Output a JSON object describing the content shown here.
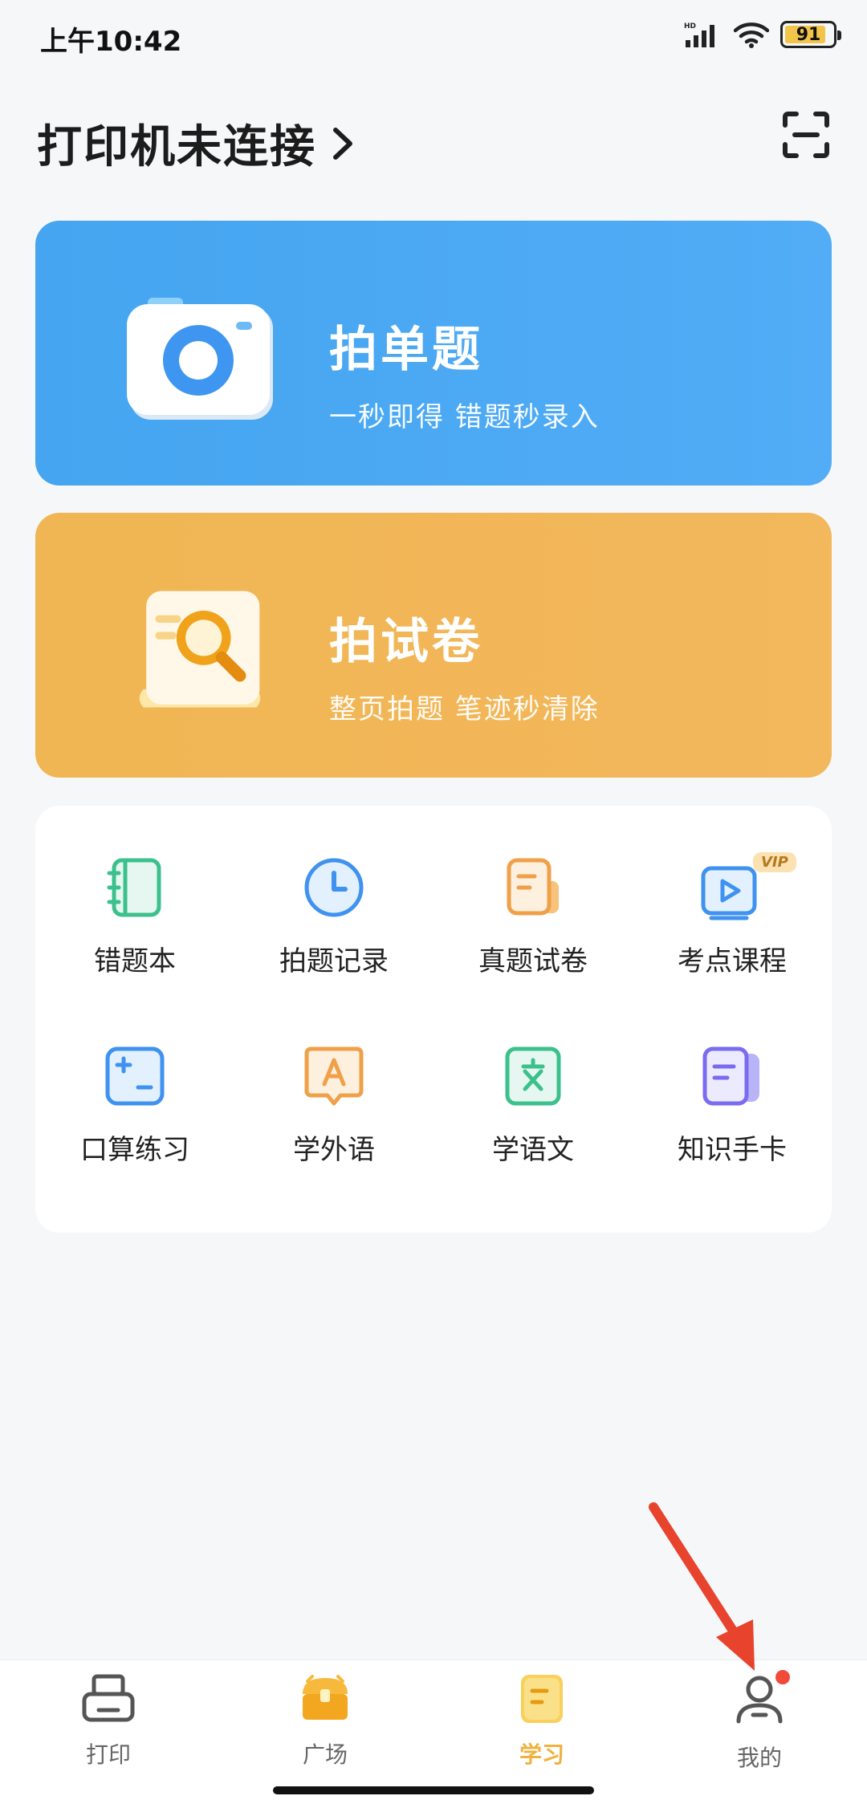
{
  "status_bar": {
    "time": "上午10:42",
    "battery": "91"
  },
  "header": {
    "printer_status": "打印机未连接"
  },
  "cards": [
    {
      "title": "拍单题",
      "subtitle": "一秒即得 错题秒录入"
    },
    {
      "title": "拍试卷",
      "subtitle": "整页拍题 笔迹秒清除"
    }
  ],
  "tools": [
    {
      "label": "错题本",
      "icon": "notebook-icon"
    },
    {
      "label": "拍题记录",
      "icon": "clock-icon"
    },
    {
      "label": "真题试卷",
      "icon": "exam-paper-icon"
    },
    {
      "label": "考点课程",
      "icon": "video-vip-icon",
      "badge": "VIP"
    },
    {
      "label": "口算练习",
      "icon": "math-icon"
    },
    {
      "label": "学外语",
      "icon": "language-icon"
    },
    {
      "label": "学语文",
      "icon": "chinese-icon"
    },
    {
      "label": "知识手卡",
      "icon": "cards-icon"
    }
  ],
  "nav": [
    {
      "label": "打印",
      "icon": "printer-icon"
    },
    {
      "label": "广场",
      "icon": "treasure-chest-icon"
    },
    {
      "label": "学习",
      "icon": "study-icon",
      "active": true
    },
    {
      "label": "我的",
      "icon": "profile-icon"
    }
  ],
  "colors": {
    "blue_card": "#4aa8f2",
    "orange_card": "#f1b657",
    "active_tab": "#f0b23e",
    "annotation_arrow": "#e8432d"
  }
}
